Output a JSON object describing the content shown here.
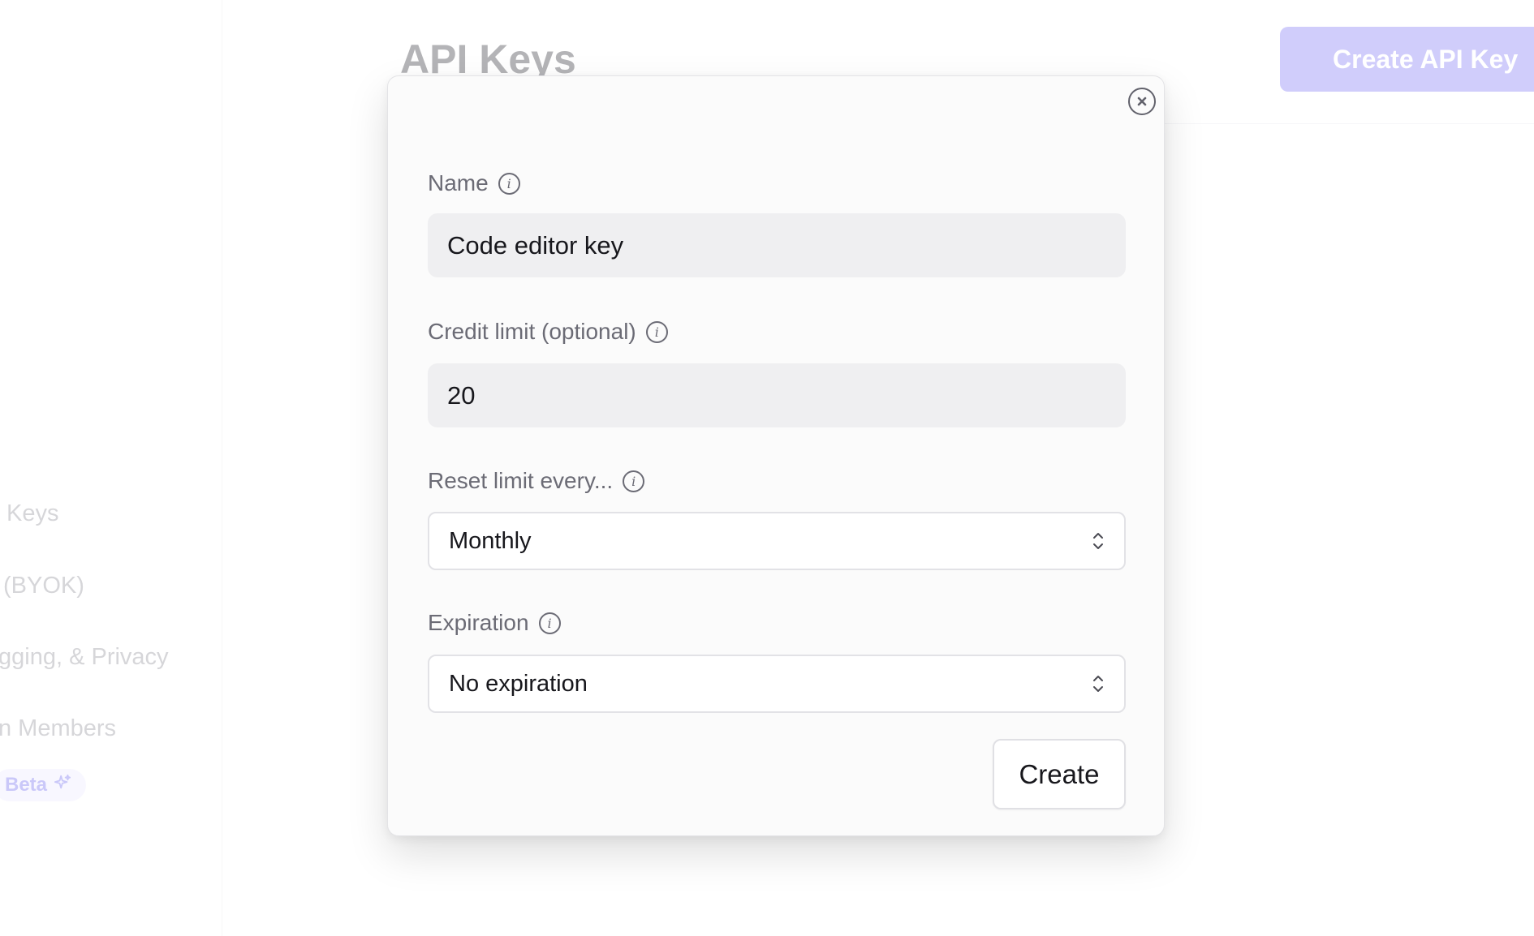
{
  "background": {
    "page_title": "API Keys",
    "create_button_label": "Create API Key",
    "sidebar": {
      "items": [
        {
          "label": "Keys"
        },
        {
          "label": "(BYOK)"
        },
        {
          "label": "gging, & Privacy"
        },
        {
          "label": "n Members"
        }
      ],
      "beta_label": "Beta"
    }
  },
  "modal": {
    "fields": {
      "name": {
        "label": "Name",
        "value": "Code editor key"
      },
      "credit_limit": {
        "label": "Credit limit (optional)",
        "value": "20"
      },
      "reset_limit": {
        "label": "Reset limit every...",
        "selected": "Monthly"
      },
      "expiration": {
        "label": "Expiration",
        "selected": "No expiration"
      }
    },
    "info_glyph": "i",
    "submit_label": "Create"
  },
  "icons": {
    "close": "close-icon",
    "info": "info-icon",
    "chevrons": "chevron-up-down-icon",
    "sparkle": "sparkle-icon"
  },
  "colors": {
    "accent": "#7b72f5",
    "beta_bg": "#ecebff",
    "input_bg": "#efeff1",
    "label": "#6b6b75"
  }
}
